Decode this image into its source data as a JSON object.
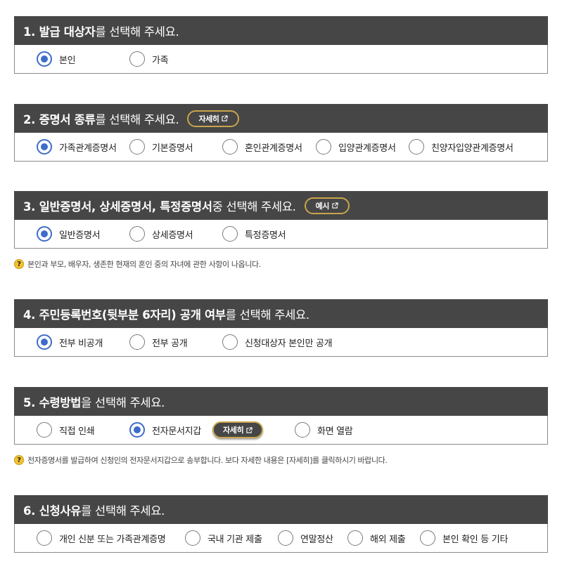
{
  "sections": [
    {
      "title_bold": "1. 발급 대상자",
      "title_rest": "를 선택해 주세요.",
      "options": [
        {
          "label": "본인",
          "selected": true
        },
        {
          "label": "가족",
          "selected": false
        }
      ]
    },
    {
      "title_bold": "2. 증명서 종류",
      "title_rest": "를 선택해 주세요.",
      "button": "자세히",
      "options": [
        {
          "label": "가족관계증명서",
          "selected": true
        },
        {
          "label": "기본증명서",
          "selected": false
        },
        {
          "label": "혼인관계증명서",
          "selected": false
        },
        {
          "label": "입양관계증명서",
          "selected": false
        },
        {
          "label": "친양자입양관계증명서",
          "selected": false
        }
      ]
    },
    {
      "title_bold": "3. 일반증명서, 상세증명서, 특정증명서",
      "title_rest": " 중 선택해 주세요.",
      "button": "예시",
      "options": [
        {
          "label": "일반증명서",
          "selected": true
        },
        {
          "label": "상세증명서",
          "selected": false
        },
        {
          "label": "특정증명서",
          "selected": false
        }
      ],
      "note": "본인과 부모, 배우자, 생존한 현재의 혼인 중의 자녀에 관한 사항이 나옵니다."
    },
    {
      "title_bold": "4. 주민등록번호(뒷부분 6자리) 공개 여부",
      "title_rest": "를 선택해 주세요.",
      "options": [
        {
          "label": "전부 비공개",
          "selected": true
        },
        {
          "label": "전부 공개",
          "selected": false
        },
        {
          "label": "신청대상자 본인만 공개",
          "selected": false
        }
      ]
    },
    {
      "title_bold": "5. 수령방법",
      "title_rest": "을 선택해 주세요.",
      "options": [
        {
          "label": "직접 인쇄",
          "selected": false
        },
        {
          "label": "전자문서지갑",
          "selected": true,
          "button": "자세히"
        },
        {
          "label": "화면 열람",
          "selected": false
        }
      ],
      "note": "전자증명서를 발급하여 신청인의 전자문서지갑으로 송부합니다. 보다 자세한 내용은 [자세히]를 클릭하시기 바랍니다."
    },
    {
      "title_bold": "6. 신청사유",
      "title_rest": "를 선택해 주세요.",
      "options": [
        {
          "label": "개인 신분 또는 가족관계증명",
          "selected": false
        },
        {
          "label": "국내 기관 제출",
          "selected": false
        },
        {
          "label": "연말정산",
          "selected": false
        },
        {
          "label": "해외 제출",
          "selected": false
        },
        {
          "label": "본인 확인 등 기타",
          "selected": false
        }
      ]
    }
  ],
  "icons": {
    "external": "external-link-icon",
    "help": "question-icon"
  },
  "colors": {
    "header_bg": "#464646",
    "radio_on": "#3e6cc9",
    "pill_border": "#c9a54b",
    "help_bg": "#f2c230"
  }
}
